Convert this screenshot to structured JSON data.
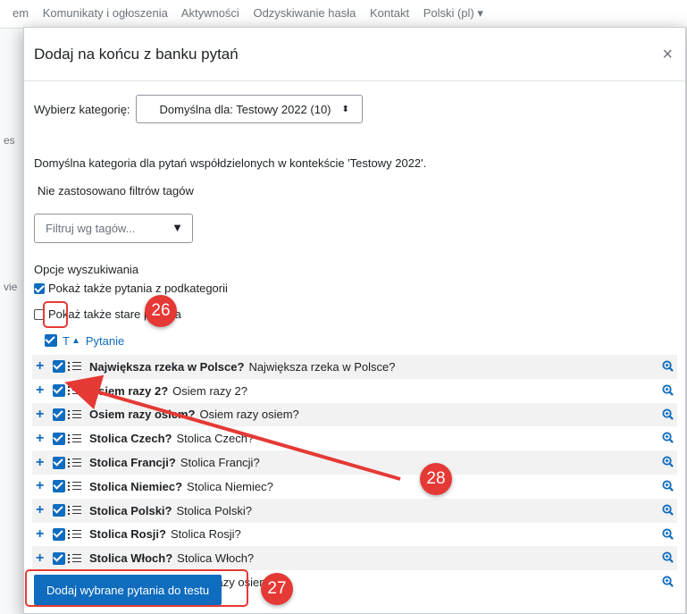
{
  "background": {
    "nav_items": [
      "em",
      "Komunikaty i ogłoszenia",
      "Aktywności",
      "Odzyskiwanie hasła",
      "Kontakt",
      "Polski (pl) ▾"
    ],
    "left_fragments": [
      "es",
      "vie"
    ]
  },
  "modal": {
    "title": "Dodaj na końcu z banku pytań",
    "close_glyph": "×",
    "category_label": "Wybierz kategorię:",
    "category_value": "Domyślna dla: Testowy 2022 (10)",
    "category_arrow": "⬍",
    "description": "Domyślna kategoria dla pytań współdzielonych w kontekście 'Testowy 2022'.",
    "no_filter": "Nie zastosowano filtrów tagów",
    "tag_filter_placeholder": "Filtruj wg tagów...",
    "tag_filter_arrow": "▼",
    "search_options_title": "Opcje wyszukiwania",
    "option_subcategories": "Pokaż także pytania z podkategorii",
    "option_subcategories_checked": true,
    "option_old": "Pokaż także stare pytania",
    "option_old_checked": false,
    "header_t": "T",
    "header_sort": "▲",
    "header_question": "Pytanie",
    "questions": [
      {
        "name": "Największa rzeka w Polsce?",
        "text": "Największa rzeka w Polsce?"
      },
      {
        "name": "Osiem razy 2?",
        "text": "Osiem razy 2?"
      },
      {
        "name": "Osiem razy osiem?",
        "text": "Osiem razy osiem?"
      },
      {
        "name": "Stolica Czech?",
        "text": "Stolica Czech?"
      },
      {
        "name": "Stolica Francji?",
        "text": "Stolica Francji?"
      },
      {
        "name": "Stolica Niemiec?",
        "text": "Stolica Niemiec?"
      },
      {
        "name": "Stolica Polski?",
        "text": "Stolica Polski?"
      },
      {
        "name": "Stolica Rosji?",
        "text": "Stolica Rosji?"
      },
      {
        "name": "Stolica Włoch?",
        "text": "Stolica Włoch?"
      },
      {
        "name": "Trzy razy osiem?",
        "text": "Trzy razy osiem?"
      }
    ],
    "add_button": "Dodaj wybrane pytania do testu"
  },
  "annotations": {
    "badge_26": "26",
    "badge_27": "27",
    "badge_28": "28",
    "color": "#e53935"
  },
  "colors": {
    "primary": "#0f6cbf",
    "stripe": "#f2f2f2"
  }
}
